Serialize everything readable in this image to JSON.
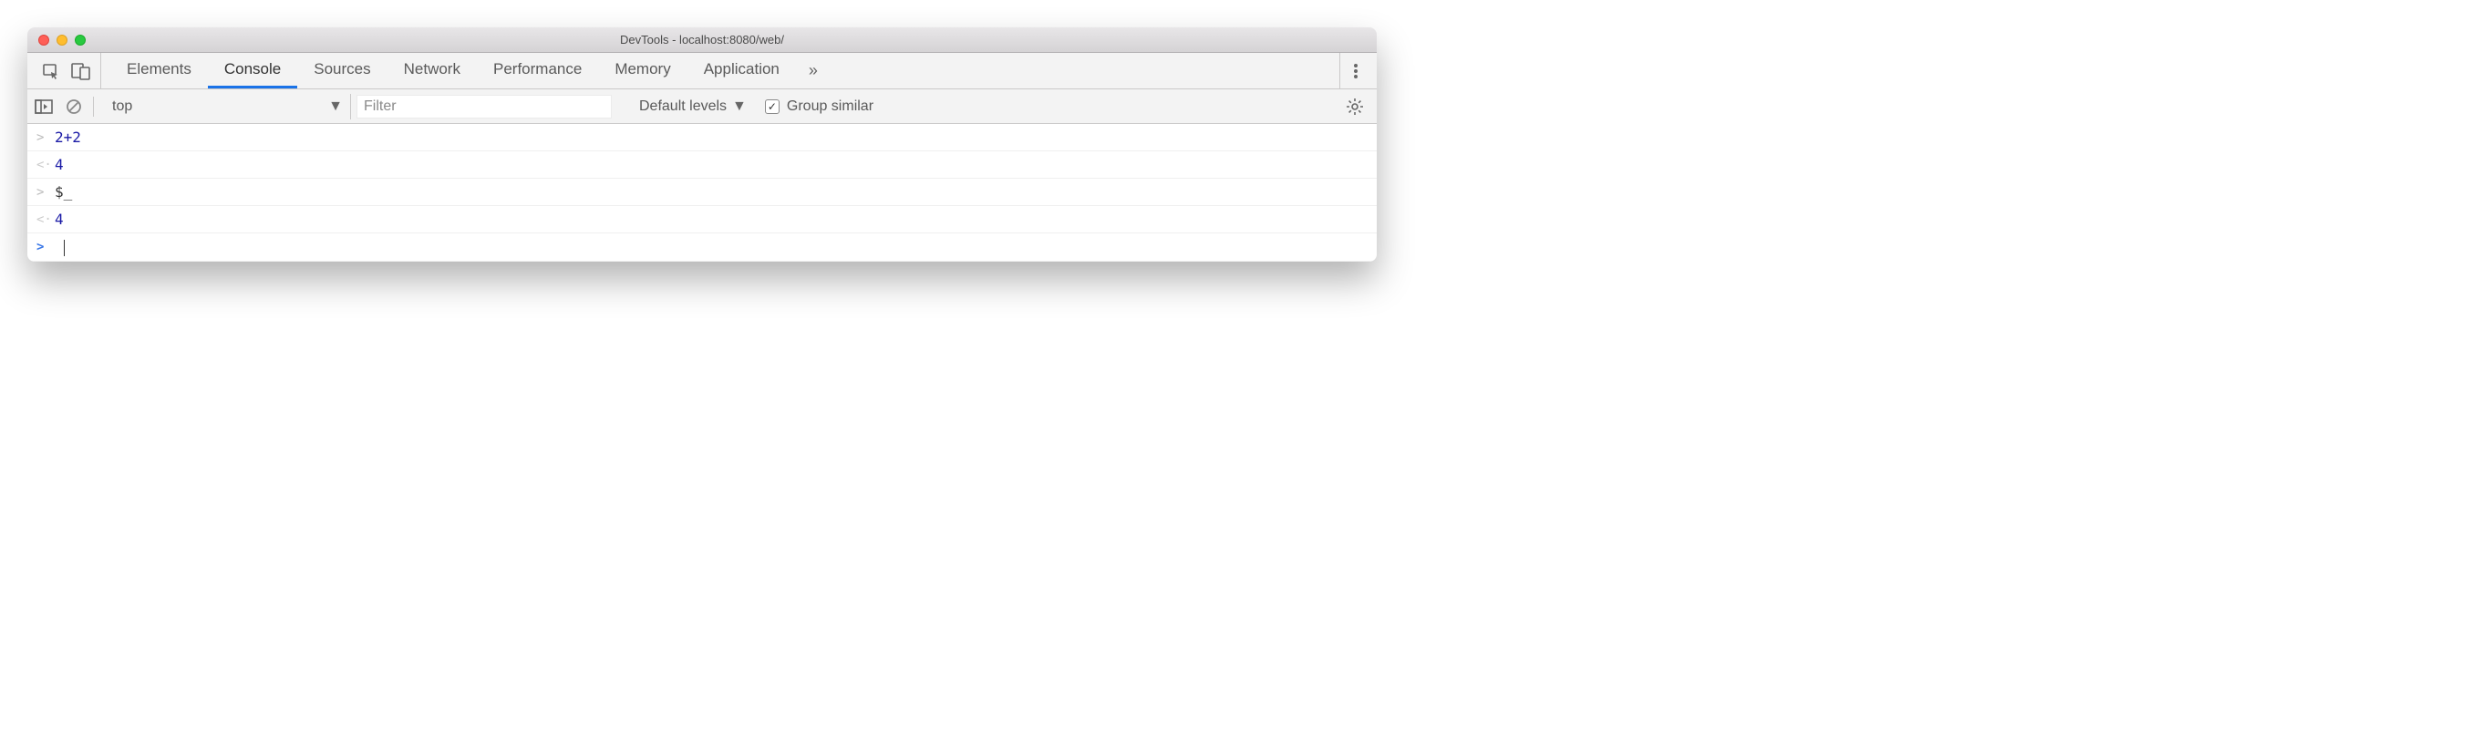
{
  "window": {
    "title": "DevTools - localhost:8080/web/"
  },
  "tabs": {
    "items": [
      "Elements",
      "Console",
      "Sources",
      "Network",
      "Performance",
      "Memory",
      "Application"
    ],
    "active": "Console",
    "overflow_glyph": "»"
  },
  "toolbar": {
    "context": "top",
    "filter_placeholder": "Filter",
    "levels_label": "Default levels",
    "group_label": "Group similar",
    "group_checked": true
  },
  "console": {
    "rows": [
      {
        "kind": "input",
        "tokens": [
          [
            "num",
            "2"
          ],
          [
            "op",
            "+"
          ],
          [
            "num",
            "2"
          ]
        ]
      },
      {
        "kind": "output",
        "tokens": [
          [
            "res",
            "4"
          ]
        ]
      },
      {
        "kind": "input",
        "tokens": [
          [
            "sym",
            "$_"
          ]
        ]
      },
      {
        "kind": "output",
        "tokens": [
          [
            "res",
            "4"
          ]
        ]
      },
      {
        "kind": "prompt"
      }
    ]
  }
}
